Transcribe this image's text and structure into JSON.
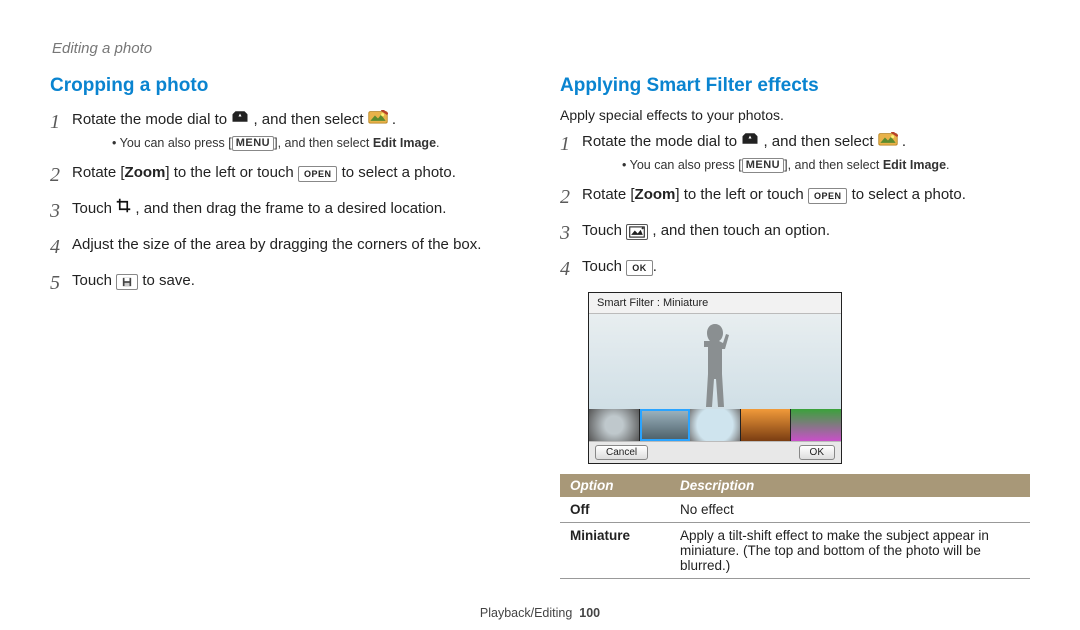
{
  "header": {
    "breadcrumb": "Editing a photo"
  },
  "left": {
    "title": "Cropping a photo",
    "steps": [
      {
        "num": "1",
        "pre": "Rotate the mode dial to ",
        "mid": ", and then select ",
        "post": ".",
        "note_pre": "You can also press [",
        "note_menu": "MENU",
        "note_mid": "], and then select ",
        "note_bold": "Edit Image",
        "note_post": "."
      },
      {
        "num": "2",
        "pre": "Rotate [",
        "zoom": "Zoom",
        "mid": "] to the left or touch ",
        "open": "OPEN",
        "post": " to select a photo."
      },
      {
        "num": "3",
        "pre": "Touch ",
        "post": ", and then drag the frame to a desired location."
      },
      {
        "num": "4",
        "text": "Adjust the size of the area by dragging the corners of the box."
      },
      {
        "num": "5",
        "pre": "Touch ",
        "save_icon": "save",
        "post": " to save."
      }
    ]
  },
  "right": {
    "title": "Applying Smart Filter effects",
    "subtitle": "Apply special effects to your photos.",
    "steps": [
      {
        "num": "1",
        "pre": "Rotate the mode dial to ",
        "mid": ", and then select ",
        "post": ".",
        "note_pre": "You can also press [",
        "note_menu": "MENU",
        "note_mid": "], and then select ",
        "note_bold": "Edit Image",
        "note_post": "."
      },
      {
        "num": "2",
        "pre": "Rotate [",
        "zoom": "Zoom",
        "mid": "] to the left or touch ",
        "open": "OPEN",
        "post": " to select a photo."
      },
      {
        "num": "3",
        "pre": "Touch ",
        "post": ", and then touch an option."
      },
      {
        "num": "4",
        "pre": "Touch ",
        "ok": "OK",
        "post": "."
      }
    ],
    "preview": {
      "label": "Smart Filter : Miniature",
      "cancel": "Cancel",
      "ok": "OK",
      "thumbs": [
        {
          "bg": "radial-gradient(circle at 50% 50%, #bfc8cc 30%, #555 100%)"
        },
        {
          "bg": "linear-gradient(#9fb6c2,#4a5d66)",
          "selected": true
        },
        {
          "bg": "radial-gradient(circle at 50% 50%, #cfe4ee 60%, #777 100%)"
        },
        {
          "bg": "linear-gradient(#f19a3a,#7a3d12)"
        },
        {
          "bg": "linear-gradient(#3aa23a,#c94fc9)"
        }
      ]
    },
    "table": {
      "headers": {
        "opt": "Option",
        "desc": "Description"
      },
      "rows": [
        {
          "opt": "Off",
          "desc": "No effect"
        },
        {
          "opt": "Miniature",
          "desc": "Apply a tilt-shift effect to make the subject appear in miniature. (The top and bottom of the photo will be blurred.)"
        }
      ]
    }
  },
  "footer": {
    "section": "Playback/Editing",
    "page": "100"
  }
}
